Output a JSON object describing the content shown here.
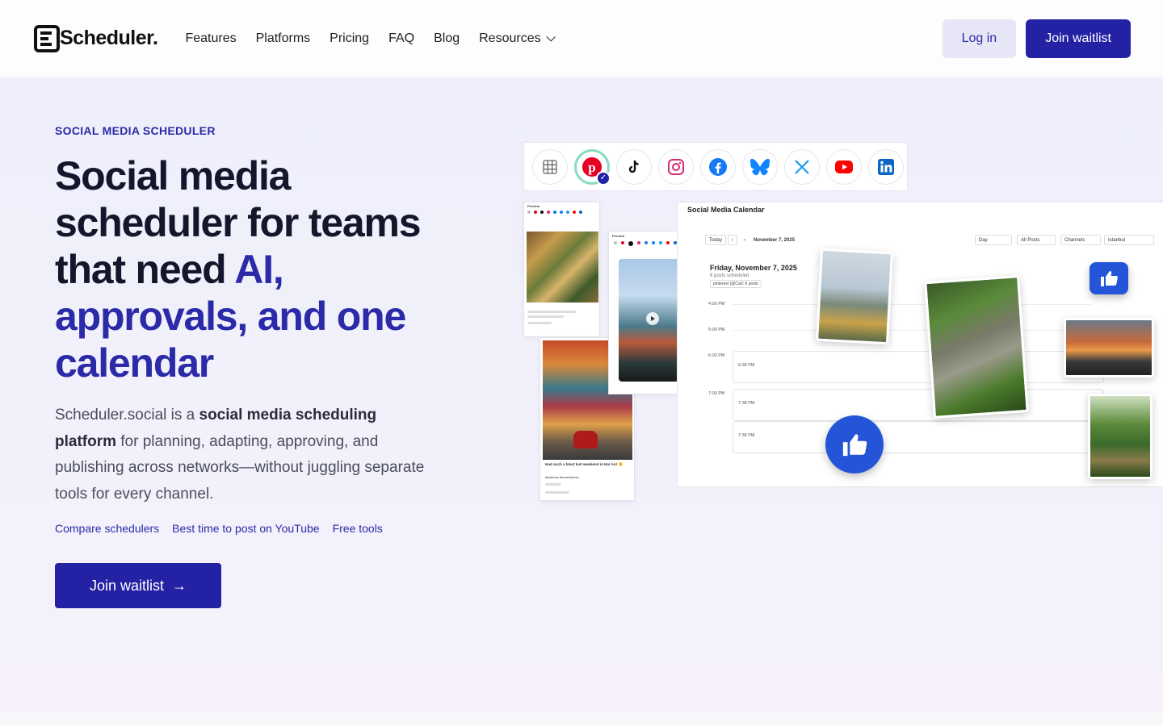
{
  "nav": {
    "logo_text": "Scheduler.",
    "links": [
      {
        "label": "Features"
      },
      {
        "label": "Platforms"
      },
      {
        "label": "Pricing"
      },
      {
        "label": "FAQ"
      },
      {
        "label": "Blog"
      },
      {
        "label": "Resources"
      }
    ],
    "login_label": "Log in",
    "join_label": "Join waitlist"
  },
  "hero": {
    "eyebrow": "SOCIAL MEDIA SCHEDULER",
    "title_part1": "Social media scheduler for teams that need ",
    "title_accent": "AI, approvals, and one calendar",
    "lead_1": "Scheduler.social is a ",
    "lead_bold": "social media scheduling platform",
    "lead_2": " for planning, adapting, approving, and publishing across networks—without juggling separate tools for every channel.",
    "quick_links": [
      "Compare schedulers",
      "Best time to post on YouTube",
      "Free tools"
    ],
    "cta_label": "Join waitlist",
    "cta_arrow": "→"
  },
  "mockup": {
    "platform_icons": [
      "grid-icon",
      "pinterest-icon",
      "tiktok-icon",
      "instagram-icon",
      "facebook-icon",
      "bluesky-icon",
      "x-icon",
      "youtube-icon",
      "linkedin-icon"
    ],
    "selected_platform": "pinterest-icon",
    "calendar": {
      "title": "Social Media Calendar",
      "today_label": "Today",
      "prev": "‹",
      "next": "›",
      "current_date": "November 7, 2025",
      "view_select": "Day",
      "posts_select": "All Posts",
      "channels_select": "Channels",
      "timezone_select": "Istanbul",
      "day_heading": "Friday, November 7, 2025",
      "day_sub": "6 posts scheduled",
      "filter_pill": "pinterest (@Cat): 6 posts",
      "times": [
        "4:00 PM",
        "5:00 PM",
        "6:00 PM",
        "7:00 PM"
      ],
      "slots": [
        "6:28 PM",
        "7:38 PM",
        "7:38 PM"
      ]
    },
    "preview_card": {
      "header": "Preview",
      "caption": "Had such a blast last weekend in Hoi An! 🙂",
      "tags": "#justimes #travelstories"
    },
    "colors": {
      "accent": "#2322a4",
      "accent_text": "#2b2aa8",
      "pinterest": "#e60023",
      "instagram": "#d62976",
      "facebook": "#1877f2",
      "bluesky": "#1185fe",
      "youtube": "#ff0000",
      "linkedin": "#0a66c2",
      "thumbs_blue": "#2454d8"
    }
  }
}
